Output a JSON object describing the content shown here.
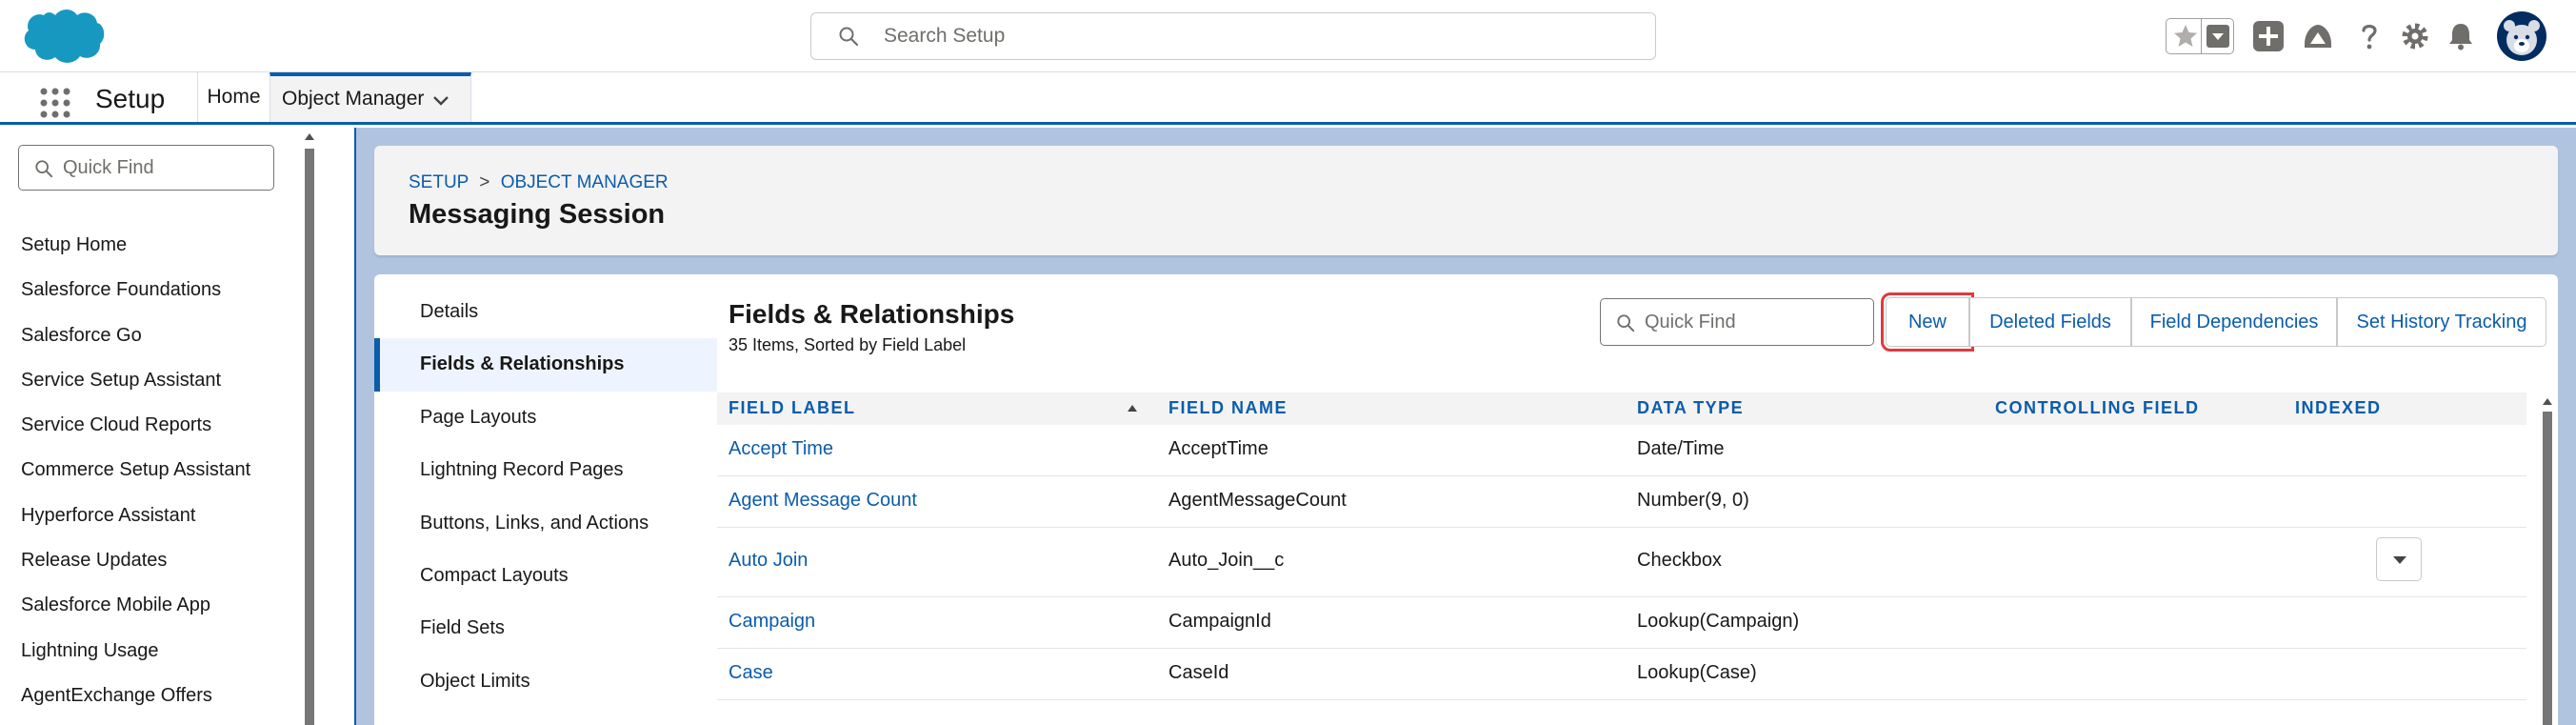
{
  "header": {
    "search_placeholder": "Search Setup"
  },
  "app_nav": {
    "app_name": "Setup",
    "tabs": [
      {
        "label": "Home"
      },
      {
        "label": "Object Manager"
      }
    ]
  },
  "left_panel": {
    "quick_find_placeholder": "Quick Find",
    "items": [
      "Setup Home",
      "Salesforce Foundations",
      "Salesforce Go",
      "Service Setup Assistant",
      "Service Cloud Reports",
      "Commerce Setup Assistant",
      "Hyperforce Assistant",
      "Release Updates",
      "Salesforce Mobile App",
      "Lightning Usage",
      "AgentExchange Offers"
    ]
  },
  "page_header": {
    "breadcrumb_setup": "SETUP",
    "breadcrumb_sep": ">",
    "breadcrumb_om": "OBJECT MANAGER",
    "title": "Messaging Session"
  },
  "object_nav": {
    "items": [
      "Details",
      "Fields & Relationships",
      "Page Layouts",
      "Lightning Record Pages",
      "Buttons, Links, and Actions",
      "Compact Layouts",
      "Field Sets",
      "Object Limits"
    ],
    "active": "Fields & Relationships"
  },
  "fields": {
    "title": "Fields & Relationships",
    "subtitle": "35 Items, Sorted by Field Label",
    "quick_find_placeholder": "Quick Find",
    "buttons": {
      "new": "New",
      "deleted": "Deleted Fields",
      "dependencies": "Field Dependencies",
      "history": "Set History Tracking"
    },
    "columns": [
      "FIELD LABEL",
      "FIELD NAME",
      "DATA TYPE",
      "CONTROLLING FIELD",
      "INDEXED"
    ],
    "rows": [
      {
        "label": "Accept Time",
        "name": "AcceptTime",
        "type": "Date/Time"
      },
      {
        "label": "Agent Message Count",
        "name": "AgentMessageCount",
        "type": "Number(9, 0)"
      },
      {
        "label": "Auto Join",
        "name": "Auto_Join__c",
        "type": "Checkbox"
      },
      {
        "label": "Campaign",
        "name": "CampaignId",
        "type": "Lookup(Campaign)"
      },
      {
        "label": "Case",
        "name": "CaseId",
        "type": "Lookup(Case)"
      }
    ]
  },
  "colors": {
    "brand_blue": "#0b5cab",
    "highlight_red": "#e0393e",
    "salesforce_cloud": "#1798c1"
  }
}
